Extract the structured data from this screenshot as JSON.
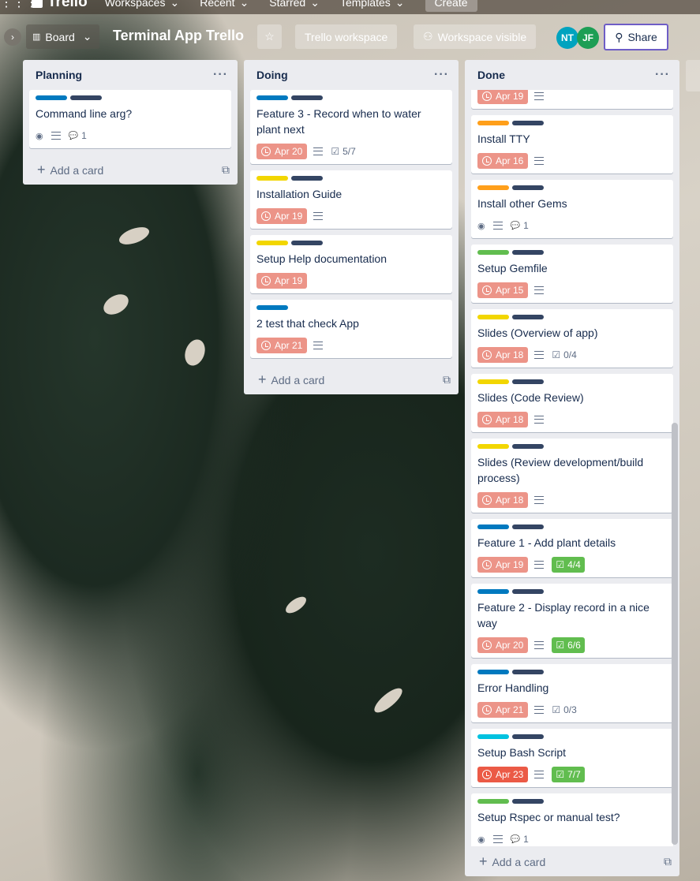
{
  "topnav": {
    "apps_icon": "apps-grid-icon",
    "logo": "Trello",
    "items": [
      "Workspaces",
      "Recent",
      "Starred",
      "Templates"
    ],
    "create": "Create"
  },
  "boardbar": {
    "view_label": "Board",
    "title": "Terminal App Trello",
    "workspace": "Trello workspace",
    "visibility": "Workspace visible",
    "share": "Share",
    "members": [
      {
        "initials": "NT",
        "color": "#00a3bf"
      },
      {
        "initials": "JF",
        "color": "#1d9e55"
      }
    ]
  },
  "colors": {
    "blue": "#0079bf",
    "navy": "#344563",
    "yellow": "#f2d600",
    "orange": "#ff9f1a",
    "green": "#61bd4f",
    "sky": "#00c2e0",
    "due_soon": "#ec9488",
    "overdue": "#eb5a46"
  },
  "add_card_label": "Add a card",
  "lists": [
    {
      "name": "Planning",
      "cards": [
        {
          "labels": [
            "blue",
            "navy"
          ],
          "title": "Command line arg?",
          "watch": true,
          "desc": true,
          "comments": "1"
        }
      ]
    },
    {
      "name": "Doing",
      "cards": [
        {
          "labels": [
            "blue",
            "navy"
          ],
          "title": "Feature 3 - Record when to water plant next",
          "due": "Apr 20",
          "desc": true,
          "checklist": "5/7"
        },
        {
          "labels": [
            "yellow",
            "navy"
          ],
          "title": "Installation Guide",
          "due": "Apr 19",
          "desc": true
        },
        {
          "labels": [
            "yellow",
            "navy"
          ],
          "title": "Setup Help documentation",
          "due": "Apr 19"
        },
        {
          "labels": [
            "blue"
          ],
          "title": "2 test that check App",
          "due": "Apr 21",
          "desc": true
        }
      ]
    },
    {
      "name": "Done",
      "partial_first": {
        "due": "Apr 19",
        "desc": true
      },
      "cards": [
        {
          "labels": [
            "orange",
            "navy"
          ],
          "title": "Install TTY",
          "due": "Apr 16",
          "desc": true
        },
        {
          "labels": [
            "orange",
            "navy"
          ],
          "title": "Install other Gems",
          "watch": true,
          "desc": true,
          "comments": "1"
        },
        {
          "labels": [
            "green",
            "navy"
          ],
          "title": "Setup Gemfile",
          "due": "Apr 15",
          "desc": true
        },
        {
          "labels": [
            "yellow",
            "navy"
          ],
          "title": "Slides (Overview of app)",
          "due": "Apr 18",
          "desc": true,
          "checklist": "0/4"
        },
        {
          "labels": [
            "yellow",
            "navy"
          ],
          "title": "Slides (Code Review)",
          "due": "Apr 18",
          "desc": true
        },
        {
          "labels": [
            "yellow",
            "navy"
          ],
          "title": "Slides (Review development/build process)",
          "due": "Apr 18",
          "desc": true
        },
        {
          "labels": [
            "blue",
            "navy"
          ],
          "title": "Feature 1 - Add plant details",
          "due": "Apr 19",
          "desc": true,
          "checklist": "4/4",
          "complete": true
        },
        {
          "labels": [
            "blue",
            "navy"
          ],
          "title": "Feature 2 - Display record in a nice way",
          "due": "Apr 20",
          "desc": true,
          "checklist": "6/6",
          "complete": true
        },
        {
          "labels": [
            "blue",
            "navy"
          ],
          "title": "Error Handling",
          "due": "Apr 21",
          "desc": true,
          "checklist": "0/3"
        },
        {
          "labels": [
            "sky",
            "navy"
          ],
          "title": "Setup Bash Script",
          "due": "Apr 23",
          "overdue": true,
          "desc": true,
          "checklist": "7/7",
          "complete": true
        },
        {
          "labels": [
            "green",
            "navy"
          ],
          "title": "Setup Rspec or manual test?",
          "watch": true,
          "desc": true,
          "comments": "1"
        }
      ]
    }
  ]
}
